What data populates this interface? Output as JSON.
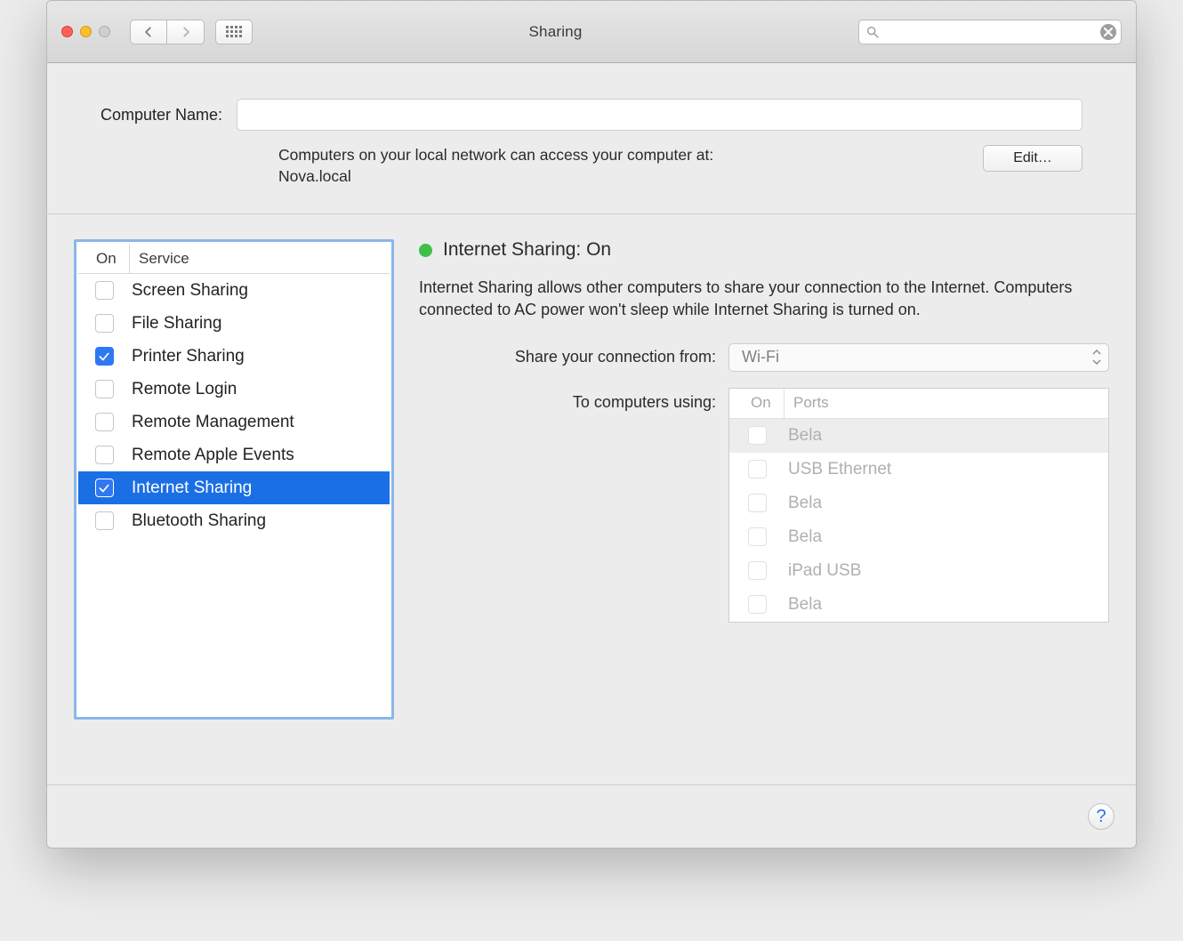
{
  "toolbar": {
    "window_title": "Sharing",
    "search_placeholder": ""
  },
  "computer_name": {
    "label": "Computer Name:",
    "value": "",
    "hint_line1": "Computers on your local network can access your computer at:",
    "hint_line2": "Nova.local",
    "edit_label": "Edit…"
  },
  "services": {
    "col_on": "On",
    "col_service": "Service",
    "items": [
      {
        "label": "Screen Sharing",
        "checked": false,
        "selected": false
      },
      {
        "label": "File Sharing",
        "checked": false,
        "selected": false
      },
      {
        "label": "Printer Sharing",
        "checked": true,
        "selected": false
      },
      {
        "label": "Remote Login",
        "checked": false,
        "selected": false
      },
      {
        "label": "Remote Management",
        "checked": false,
        "selected": false
      },
      {
        "label": "Remote Apple Events",
        "checked": false,
        "selected": false
      },
      {
        "label": "Internet Sharing",
        "checked": true,
        "selected": true
      },
      {
        "label": "Bluetooth Sharing",
        "checked": false,
        "selected": false
      }
    ]
  },
  "detail": {
    "status_title": "Internet Sharing: On",
    "status_color": "#3fbf48",
    "description": "Internet Sharing allows other computers to share your connection to the Internet. Computers connected to AC power won't sleep while Internet Sharing is turned on.",
    "share_from_label": "Share your connection from:",
    "share_from_value": "Wi-Fi",
    "to_label": "To computers using:",
    "ports_col_on": "On",
    "ports_col_ports": "Ports",
    "ports": [
      {
        "label": "Bela",
        "checked": false,
        "alt": true
      },
      {
        "label": "USB Ethernet",
        "checked": false,
        "alt": false
      },
      {
        "label": "Bela",
        "checked": false,
        "alt": false
      },
      {
        "label": "Bela",
        "checked": false,
        "alt": false
      },
      {
        "label": "iPad USB",
        "checked": false,
        "alt": false
      },
      {
        "label": "Bela",
        "checked": false,
        "alt": false
      }
    ]
  },
  "footer": {
    "help_label": "?"
  }
}
